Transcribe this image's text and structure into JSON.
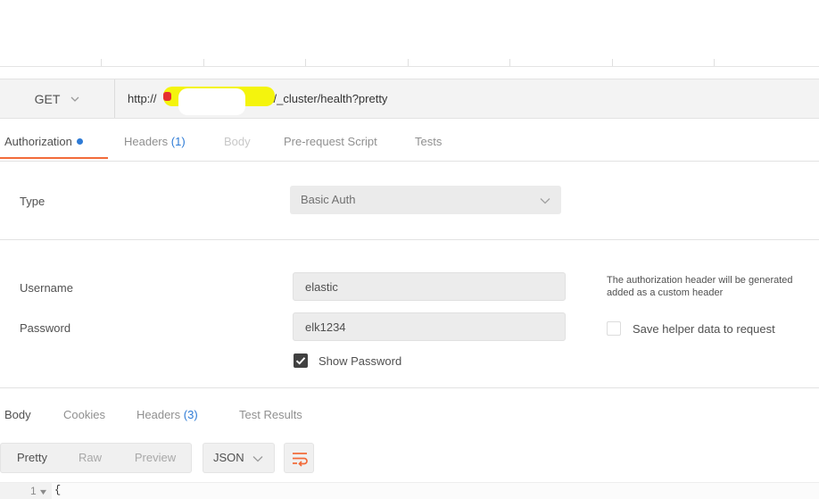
{
  "request": {
    "method": "GET",
    "url_prefix": "http://",
    "url_suffix": "/_cluster/health?pretty"
  },
  "tabs": {
    "authorization": "Authorization",
    "headers": "Headers",
    "headers_count": "(1)",
    "body": "Body",
    "prerequest": "Pre-request Script",
    "tests": "Tests"
  },
  "auth": {
    "type_label": "Type",
    "type_value": "Basic Auth",
    "username_label": "Username",
    "username_value": "elastic",
    "password_label": "Password",
    "password_value": "elk1234",
    "show_password_label": "Show Password",
    "info_line1": "The authorization header will be generated",
    "info_line2": "added as a custom header",
    "save_helper_label": "Save helper data to request"
  },
  "response_tabs": {
    "body": "Body",
    "cookies": "Cookies",
    "headers": "Headers",
    "headers_count": "(3)",
    "test_results": "Test Results"
  },
  "response_toolbar": {
    "pretty": "Pretty",
    "raw": "Raw",
    "preview": "Preview",
    "format": "JSON"
  },
  "editor": {
    "line_number": "1",
    "line_text": "{"
  },
  "colors": {
    "accent": "#f26b3a",
    "link_blue": "#2e7bd6"
  }
}
